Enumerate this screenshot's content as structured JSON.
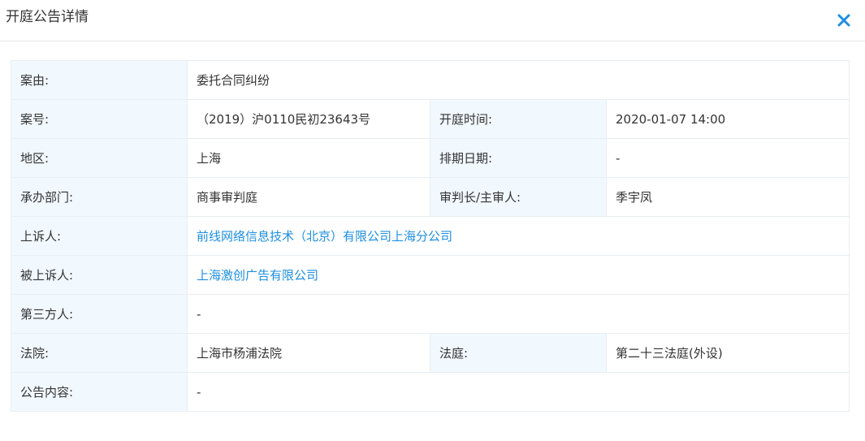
{
  "header": {
    "title": "开庭公告详情",
    "close_icon": "close-icon"
  },
  "colors": {
    "accent": "#1e8fe1",
    "label_bg": "#f1f8fe",
    "border": "#e8eef3"
  },
  "rows": {
    "case_reason": {
      "label": "案由:",
      "value": "委托合同纠纷"
    },
    "case_number": {
      "label": "案号:",
      "value": "（2019）沪0110民初23643号"
    },
    "hearing_time": {
      "label": "开庭时间:",
      "value": "2020-01-07 14:00"
    },
    "region": {
      "label": "地区:",
      "value": "上海"
    },
    "schedule_date": {
      "label": "排期日期:",
      "value": "-"
    },
    "department": {
      "label": "承办部门:",
      "value": "商事审判庭"
    },
    "presiding_judge": {
      "label": "审判长/主审人:",
      "value": "季宇凤"
    },
    "appellant": {
      "label": "上诉人:",
      "value": "前线网络信息技术（北京）有限公司上海分公司"
    },
    "appellee": {
      "label": "被上诉人:",
      "value": "上海激创广告有限公司"
    },
    "third_party": {
      "label": "第三方人:",
      "value": "-"
    },
    "court": {
      "label": "法院:",
      "value": "上海市杨浦法院"
    },
    "courtroom": {
      "label": "法庭:",
      "value": "第二十三法庭(外设)"
    },
    "announcement": {
      "label": "公告内容:",
      "value": "-"
    }
  }
}
